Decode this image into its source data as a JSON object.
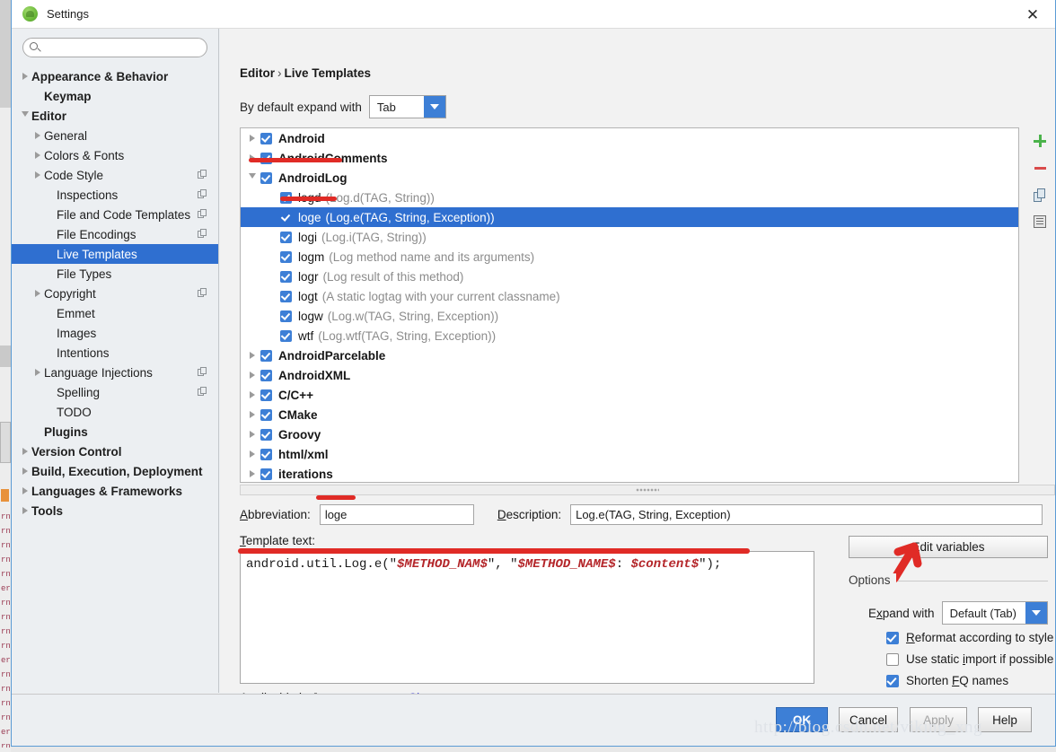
{
  "window": {
    "title": "Settings",
    "app_icon": "android-studio-icon",
    "close_icon": "close-icon"
  },
  "search": {
    "placeholder": "",
    "value": "",
    "icon": "search-icon"
  },
  "sidebar": {
    "items": [
      {
        "label": "Appearance & Behavior",
        "bold": true,
        "indent": 0,
        "arrow": "collapsed",
        "copy": false
      },
      {
        "label": "Keymap",
        "bold": true,
        "indent": 1,
        "arrow": "none",
        "copy": false
      },
      {
        "label": "Editor",
        "bold": true,
        "indent": 0,
        "arrow": "expanded",
        "copy": false
      },
      {
        "label": "General",
        "bold": false,
        "indent": 1,
        "arrow": "collapsed",
        "copy": false
      },
      {
        "label": "Colors & Fonts",
        "bold": false,
        "indent": 1,
        "arrow": "collapsed",
        "copy": false
      },
      {
        "label": "Code Style",
        "bold": false,
        "indent": 1,
        "arrow": "collapsed",
        "copy": true
      },
      {
        "label": "Inspections",
        "bold": false,
        "indent": 2,
        "arrow": "none",
        "copy": true
      },
      {
        "label": "File and Code Templates",
        "bold": false,
        "indent": 2,
        "arrow": "none",
        "copy": true
      },
      {
        "label": "File Encodings",
        "bold": false,
        "indent": 2,
        "arrow": "none",
        "copy": true
      },
      {
        "label": "Live Templates",
        "bold": false,
        "indent": 2,
        "arrow": "none",
        "copy": false,
        "selected": true
      },
      {
        "label": "File Types",
        "bold": false,
        "indent": 2,
        "arrow": "none",
        "copy": false
      },
      {
        "label": "Copyright",
        "bold": false,
        "indent": 1,
        "arrow": "collapsed",
        "copy": true
      },
      {
        "label": "Emmet",
        "bold": false,
        "indent": 2,
        "arrow": "none",
        "copy": false
      },
      {
        "label": "Images",
        "bold": false,
        "indent": 2,
        "arrow": "none",
        "copy": false
      },
      {
        "label": "Intentions",
        "bold": false,
        "indent": 2,
        "arrow": "none",
        "copy": false
      },
      {
        "label": "Language Injections",
        "bold": false,
        "indent": 1,
        "arrow": "collapsed",
        "copy": true
      },
      {
        "label": "Spelling",
        "bold": false,
        "indent": 2,
        "arrow": "none",
        "copy": true
      },
      {
        "label": "TODO",
        "bold": false,
        "indent": 2,
        "arrow": "none",
        "copy": false
      },
      {
        "label": "Plugins",
        "bold": true,
        "indent": 1,
        "arrow": "none",
        "copy": false
      },
      {
        "label": "Version Control",
        "bold": true,
        "indent": 0,
        "arrow": "collapsed",
        "copy": false
      },
      {
        "label": "Build, Execution, Deployment",
        "bold": true,
        "indent": 0,
        "arrow": "collapsed",
        "copy": false
      },
      {
        "label": "Languages & Frameworks",
        "bold": true,
        "indent": 0,
        "arrow": "collapsed",
        "copy": false
      },
      {
        "label": "Tools",
        "bold": true,
        "indent": 0,
        "arrow": "collapsed",
        "copy": false
      }
    ]
  },
  "content": {
    "breadcrumb": {
      "root": "Editor",
      "separator": "›",
      "leaf": "Live Templates"
    },
    "expand_with": {
      "label": "By default expand with",
      "value": "Tab",
      "arrow_icon": "chevron-down-icon"
    },
    "templates": [
      {
        "name": "Android",
        "desc": "",
        "group": true,
        "arrow": "collapsed",
        "checked": true,
        "indent": 0
      },
      {
        "name": "AndroidComments",
        "desc": "",
        "group": true,
        "arrow": "collapsed",
        "checked": true,
        "indent": 0
      },
      {
        "name": "AndroidLog",
        "desc": "",
        "group": true,
        "arrow": "expanded",
        "checked": true,
        "indent": 0
      },
      {
        "name": "logd",
        "desc": "(Log.d(TAG, String))",
        "group": false,
        "arrow": "none",
        "checked": true,
        "indent": 1
      },
      {
        "name": "loge",
        "desc": "(Log.e(TAG, String, Exception))",
        "group": false,
        "arrow": "none",
        "checked": true,
        "indent": 1,
        "selected": true
      },
      {
        "name": "logi",
        "desc": "(Log.i(TAG, String))",
        "group": false,
        "arrow": "none",
        "checked": true,
        "indent": 1
      },
      {
        "name": "logm",
        "desc": "(Log method name and its arguments)",
        "group": false,
        "arrow": "none",
        "checked": true,
        "indent": 1
      },
      {
        "name": "logr",
        "desc": "(Log result of this method)",
        "group": false,
        "arrow": "none",
        "checked": true,
        "indent": 1
      },
      {
        "name": "logt",
        "desc": "(A static logtag with your current classname)",
        "group": false,
        "arrow": "none",
        "checked": true,
        "indent": 1
      },
      {
        "name": "logw",
        "desc": "(Log.w(TAG, String, Exception))",
        "group": false,
        "arrow": "none",
        "checked": true,
        "indent": 1
      },
      {
        "name": "wtf",
        "desc": "(Log.wtf(TAG, String, Exception))",
        "group": false,
        "arrow": "none",
        "checked": true,
        "indent": 1
      },
      {
        "name": "AndroidParcelable",
        "desc": "",
        "group": true,
        "arrow": "collapsed",
        "checked": true,
        "indent": 0
      },
      {
        "name": "AndroidXML",
        "desc": "",
        "group": true,
        "arrow": "collapsed",
        "checked": true,
        "indent": 0
      },
      {
        "name": "C/C++",
        "desc": "",
        "group": true,
        "arrow": "collapsed",
        "checked": true,
        "indent": 0
      },
      {
        "name": "CMake",
        "desc": "",
        "group": true,
        "arrow": "collapsed",
        "checked": true,
        "indent": 0
      },
      {
        "name": "Groovy",
        "desc": "",
        "group": true,
        "arrow": "collapsed",
        "checked": true,
        "indent": 0
      },
      {
        "name": "html/xml",
        "desc": "",
        "group": true,
        "arrow": "collapsed",
        "checked": true,
        "indent": 0
      },
      {
        "name": "iterations",
        "desc": "",
        "group": true,
        "arrow": "collapsed",
        "checked": true,
        "indent": 0
      }
    ],
    "list_toolbar": [
      {
        "icon": "add-icon",
        "name": "add-template-button"
      },
      {
        "icon": "remove-icon",
        "name": "remove-template-button"
      },
      {
        "icon": "duplicate-icon",
        "name": "duplicate-template-button"
      },
      {
        "icon": "restore-icon",
        "name": "restore-defaults-button"
      }
    ],
    "abbreviation": {
      "label": "Abbreviation:",
      "value": "loge"
    },
    "description": {
      "label": "Description:",
      "value": "Log.e(TAG, String, Exception)"
    },
    "template_text": {
      "label": "Template text:",
      "value": "android.util.Log.e(\"$METHOD_NAM$\", \"$METHOD_NAME$: $content$\");",
      "segments": [
        {
          "t": "android.util.Log.e(\"",
          "style": "plain"
        },
        {
          "t": "$METHOD_NAM$",
          "style": "var"
        },
        {
          "t": "\", \"",
          "style": "plain"
        },
        {
          "t": "$METHOD_NAME$",
          "style": "var"
        },
        {
          "t": ": ",
          "style": "plain"
        },
        {
          "t": "$content$",
          "style": "var"
        },
        {
          "t": "\");",
          "style": "plain"
        }
      ]
    },
    "applicable": {
      "text": "Applicable in Java: statement.",
      "link": "Change"
    },
    "options": {
      "edit_variables_label": "Edit variables",
      "title": "Options",
      "expand_with": {
        "label": "Expand with",
        "value": "Default (Tab)",
        "arrow_icon": "chevron-down-icon"
      },
      "checkboxes": [
        {
          "label": "Reformat according to style",
          "checked": true
        },
        {
          "label": "Use static import if possible",
          "checked": false
        },
        {
          "label": "Shorten FQ names",
          "checked": true
        }
      ]
    }
  },
  "buttons": [
    {
      "label": "OK",
      "style": "primary"
    },
    {
      "label": "Cancel",
      "style": "normal"
    },
    {
      "label": "Apply",
      "style": "disabled"
    },
    {
      "label": "Help",
      "style": "normal"
    }
  ],
  "watermark": "http://blog.csdn.net/viking_xng",
  "colors": {
    "accent": "#3d7fd6",
    "selection": "#2f6fd0",
    "annotation": "#e02b26",
    "link": "#3b3bd4"
  }
}
